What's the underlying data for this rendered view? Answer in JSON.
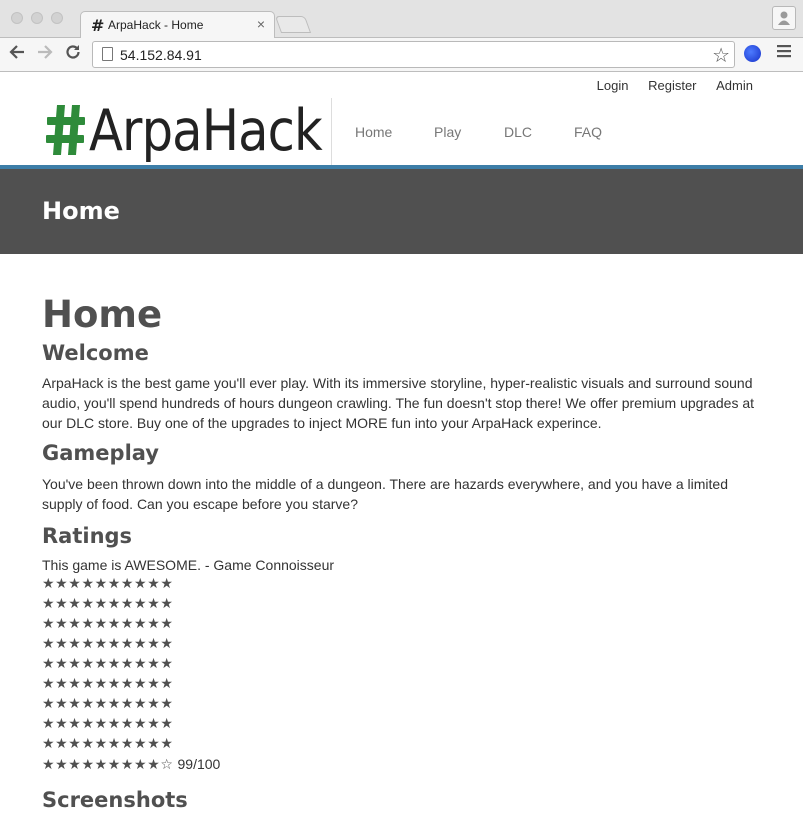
{
  "browser": {
    "tab_title": "ArpaHack - Home",
    "tab_close": "×",
    "url": "54.152.84.91",
    "icons": [
      "back-icon",
      "forward-icon",
      "reload-icon",
      "page-icon",
      "bookmark-star-icon",
      "extension-icon",
      "menu-icon",
      "profile-icon"
    ]
  },
  "site": {
    "top_links": [
      "Login",
      "Register",
      "Admin"
    ],
    "logo": {
      "text": "ArpaHack",
      "hash_color": "#2e7d32"
    },
    "nav": [
      "Home",
      "Play",
      "DLC",
      "FAQ"
    ],
    "banner_title": "Home",
    "accent_color": "#3d7ea8"
  },
  "content": {
    "page_title": "Home",
    "welcome": {
      "heading": "Welcome",
      "text": "ArpaHack is the best game you'll ever play. With its immersive storyline, hyper-realistic visuals and surround sound audio, you'll spend hundreds of hours dungeon crawling. The fun doesn't stop there! We offer premium upgrades at our DLC store. Buy one of the upgrades to inject MORE fun into your ArpaHack experince."
    },
    "gameplay": {
      "heading": "Gameplay",
      "text": "You've been thrown down into the middle of a dungeon. There are hazards everywhere, and you have a limited supply of food. Can you escape before you starve?"
    },
    "ratings": {
      "heading": "Ratings",
      "quote": "This game is AWESOME. - Game Connoisseur",
      "star_rows": [
        "★★★★★★★★★★",
        "★★★★★★★★★★",
        "★★★★★★★★★★",
        "★★★★★★★★★★",
        "★★★★★★★★★★",
        "★★★★★★★★★★",
        "★★★★★★★★★★",
        "★★★★★★★★★★",
        "★★★★★★★★★★",
        "★★★★★★★★★☆"
      ],
      "score": "99/100"
    },
    "next_heading": "Screenshots"
  }
}
